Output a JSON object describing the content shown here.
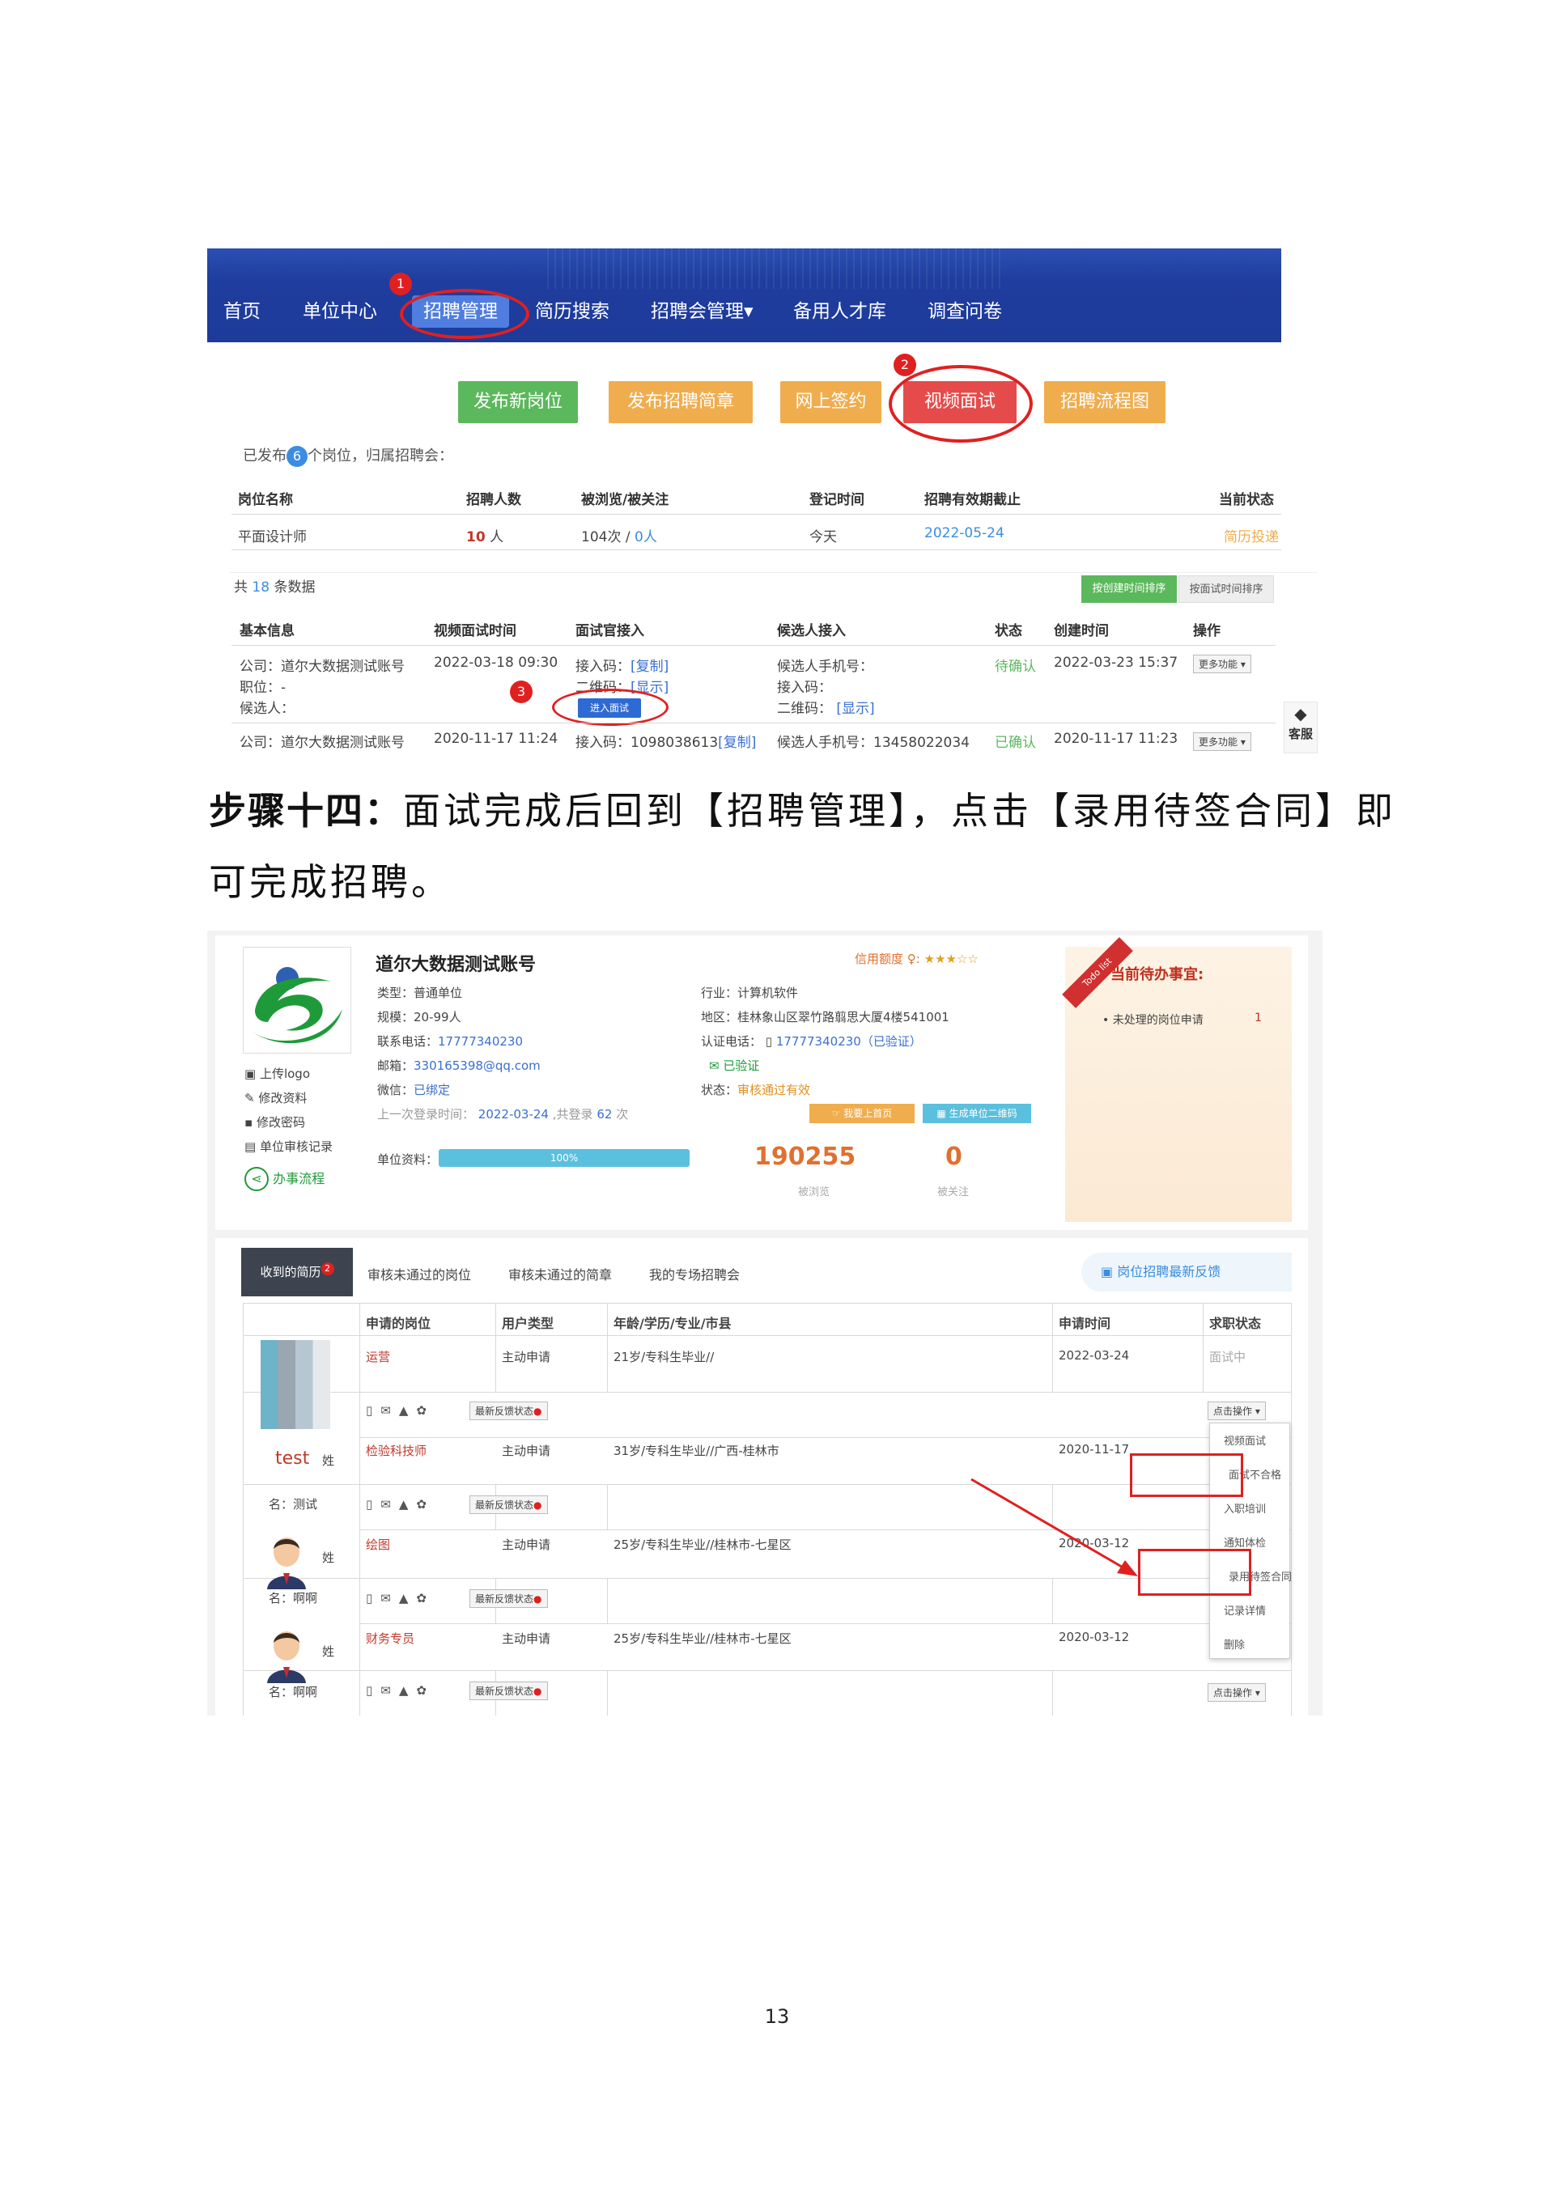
{
  "fig1": {
    "nav": [
      "首页",
      "单位中心",
      "招聘管理",
      "简历搜索",
      "招聘会管理▾",
      "备用人才库",
      "调查问卷"
    ],
    "markers": [
      "1",
      "2",
      "3"
    ],
    "buttons": [
      {
        "label": "发布新岗位",
        "color": "#5cb85c"
      },
      {
        "label": "发布招聘简章",
        "color": "#f0ad4e"
      },
      {
        "label": "网上签约",
        "color": "#f0ad4e"
      },
      {
        "label": "视频面试",
        "color": "#e64b4b"
      },
      {
        "label": "招聘流程图",
        "color": "#f0ad4e"
      }
    ],
    "published_prefix": "已发布",
    "published_count": "6",
    "published_suffix": "个岗位，归属招聘会：",
    "job_table": {
      "headers": [
        "岗位名称",
        "招聘人数",
        "被浏览/被关注",
        "登记时间",
        "招聘有效期截止",
        "当前状态"
      ],
      "row": [
        "平面设计师",
        "10",
        "人",
        "104次 /",
        "0人",
        "今天",
        "2022-05-24",
        "简历投递"
      ]
    },
    "total_prefix": "共",
    "total_count": "18",
    "total_suffix": "条数据",
    "sort_buttons": [
      "按创建时间排序",
      "按面试时间排序"
    ],
    "interview_table": {
      "headers": [
        "基本信息",
        "视频面试时间",
        "面试官接入",
        "候选人接入",
        "状态",
        "创建时间",
        "操作"
      ],
      "row1": {
        "company": "公司：道尔大数据测试账号",
        "position": "职位：-",
        "candidate": "候选人：",
        "time": "2022-03-18 09:30",
        "code_label": "接入码：",
        "copy": "[复制]",
        "qr_label": "二维码：",
        "show": "[显示]",
        "enter": "进入面试",
        "cand_phone": "候选人手机号：",
        "cand_code": "接入码：",
        "cand_qr": "二维码：",
        "cand_show": "[显示]",
        "status": "待确认",
        "created": "2022-03-23 15:37",
        "more": "更多功能 ▾"
      },
      "row2": {
        "company": "公司：道尔大数据测试账号",
        "time": "2020-11-17 11:24",
        "code": "接入码：1098038613",
        "copy": "[复制]",
        "cand_phone": "候选人手机号：13458022034",
        "status": "已确认",
        "created": "2020-11-17 11:23",
        "more": "更多功能 ▾"
      }
    },
    "service": "客服"
  },
  "caption": {
    "step": "步骤十四：",
    "text": "面试完成后回到【招聘管理】，点击【录用待签合同】即可完成招聘。"
  },
  "fig2": {
    "company_name": "道尔大数据测试账号",
    "credit_label": "信用额度",
    "stars": "★★★☆☆",
    "left_info": [
      {
        "label": "类型：",
        "value": "普通单位"
      },
      {
        "label": "规模：",
        "value": "20-99人"
      },
      {
        "label": "联系电话：",
        "value": "17777340230"
      },
      {
        "label": "邮箱：",
        "value": "330165398@qq.com"
      },
      {
        "label": "微信：",
        "value": "已绑定"
      }
    ],
    "last_login_label": "上一次登录时间：",
    "last_login": "2022-03-24",
    "login_total_label": "共登录",
    "login_total": "62",
    "login_unit": "次",
    "right_info": [
      {
        "label": "行业：",
        "value": "计算机软件"
      },
      {
        "label": "地区：",
        "value": "桂林象山区翠竹路翦思大厦4楼541001"
      },
      {
        "label": "认证电话：",
        "value": "17777340230（已验证）"
      },
      {
        "label": "",
        "value": "已验证"
      },
      {
        "label": "状态：",
        "value": "审核通过有效"
      }
    ],
    "top_btns": [
      "我要上首页",
      "生成单位二维码"
    ],
    "side_links": [
      "上传logo",
      "修改资料",
      "修改密码",
      "单位审核记录"
    ],
    "process_link": "办事流程",
    "profile_label": "单位资料：",
    "profile_pct": "100%",
    "views": "190255",
    "views_label": "被浏览",
    "follows": "0",
    "follows_label": "被关注",
    "todo_ribbon": "Todo list",
    "todo_title": "当前待办事宜:",
    "todo_item": "未处理的岗位申请",
    "todo_count": "1",
    "tabs": [
      "收到的简历",
      "审核未通过的岗位",
      "审核未通过的简章",
      "我的专场招聘会"
    ],
    "tab_badge": "2",
    "feedback": "岗位招聘最新反馈",
    "table_headers": [
      "申请的岗位",
      "用户类型",
      "年龄/学历/专业/市县",
      "申请时间",
      "求职状态"
    ],
    "rows": [
      {
        "job": "运营",
        "type": "主动申请",
        "info": "21岁/专科生毕业//",
        "date": "2022-03-24",
        "status": "面试中"
      },
      {
        "job": "检验科技师",
        "type": "主动申请",
        "info": "31岁/专科生毕业//广西-桂林市",
        "date": "2020-11-17",
        "status": ""
      },
      {
        "job": "绘图",
        "type": "主动申请",
        "info": "25岁/专科生毕业//桂林市-七星区",
        "date": "2020-03-12",
        "status": ""
      },
      {
        "job": "财务专员",
        "type": "主动申请",
        "info": "25岁/专科生毕业//桂林市-七星区",
        "date": "2020-03-12",
        "status": ""
      }
    ],
    "name_labels": {
      "test": "test",
      "xing": "姓",
      "ming1": "名：测试",
      "ming2": "名：啊啊",
      "ming3": "名：啊啊"
    },
    "feedback_btn": "最新反馈状态",
    "op_btn": "点击操作 ▾",
    "menu": [
      "视频面试",
      "面试不合格",
      "入职培训",
      "通知体检",
      "录用待签合同",
      "记录详情",
      "删除"
    ]
  },
  "page_number": "13"
}
